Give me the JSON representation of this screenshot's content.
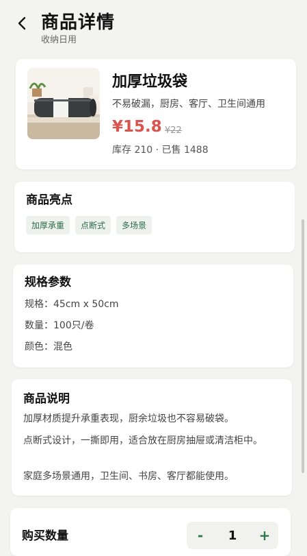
{
  "header": {
    "title": "商品详情",
    "subtitle": "收纳日用"
  },
  "product": {
    "name": "加厚垃圾袋",
    "desc": "不易破漏，厨房、客厅、卫生间通用",
    "price": "¥15.8",
    "old_price": "¥22",
    "stock_sales": "库存 210 · 已售 1488",
    "image_icon": "garbage-bag-roll-image"
  },
  "highlights": {
    "title": "商品亮点",
    "tags": [
      "加厚承重",
      "点断式",
      "多场景"
    ]
  },
  "specs": {
    "title": "规格参数",
    "lines": [
      "规格：45cm x 50cm",
      "数量：100只/卷",
      "颜色：混色"
    ]
  },
  "description": {
    "title": "商品说明",
    "paragraphs": [
      "加厚材质提升承重表现，厨余垃圾也不容易破袋。",
      "点断式设计，一撕即用，适合放在厨房抽屉或清洁柜中。",
      "家庭多场景通用，卫生间、书房、客厅都能使用。"
    ]
  },
  "quantity": {
    "title": "购买数量",
    "minus": "-",
    "value": "1",
    "plus": "+"
  },
  "colors": {
    "price": "#d9534f",
    "accent": "#2e7a4b"
  }
}
